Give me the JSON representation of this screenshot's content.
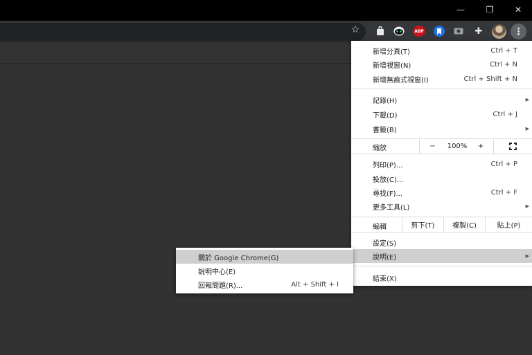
{
  "window_controls": {
    "minimize_glyph": "—",
    "maximize_glyph": "❐",
    "close_glyph": "✕"
  },
  "toolbar": {
    "star_glyph": "☆",
    "extensions": [
      "shopping-bag-icon",
      "ghost-icon",
      "adblock-plus-icon",
      "bookmark-icon",
      "camera-icon",
      "puzzle-extensions-icon"
    ],
    "abp_label": "ABP",
    "puzzle_glyph": "✚",
    "menu_glyph": "⋮"
  },
  "menu": {
    "new_tab": {
      "label": "新增分頁(T)",
      "shortcut": "Ctrl + T"
    },
    "new_window": {
      "label": "新增視窗(N)",
      "shortcut": "Ctrl + N"
    },
    "new_incognito": {
      "label": "新增無痕式視窗(I)",
      "shortcut": "Ctrl + Shift + N"
    },
    "history": {
      "label": "記錄(H)"
    },
    "downloads": {
      "label": "下載(D)",
      "shortcut": "Ctrl + J"
    },
    "bookmarks": {
      "label": "書籤(B)"
    },
    "zoom": {
      "label": "縮放",
      "minus": "−",
      "value": "100%",
      "plus": "+"
    },
    "print": {
      "label": "列印(P)...",
      "shortcut": "Ctrl + P"
    },
    "cast": {
      "label": "投放(C)..."
    },
    "find": {
      "label": "尋找(F)...",
      "shortcut": "Ctrl + F"
    },
    "more_tools": {
      "label": "更多工具(L)"
    },
    "edit": {
      "label": "編輯",
      "cut": "剪下(T)",
      "copy": "複製(C)",
      "paste": "貼上(P)"
    },
    "settings": {
      "label": "設定(S)"
    },
    "help": {
      "label": "說明(E)"
    },
    "exit": {
      "label": "結束(X)"
    },
    "arrow_glyph": "▶"
  },
  "help_submenu": {
    "about": {
      "label": "關於 Google Chrome(G)"
    },
    "help_center": {
      "label": "說明中心(E)"
    },
    "report_issue": {
      "label": "回報問題(R)...",
      "shortcut": "Alt + Shift + I"
    }
  }
}
